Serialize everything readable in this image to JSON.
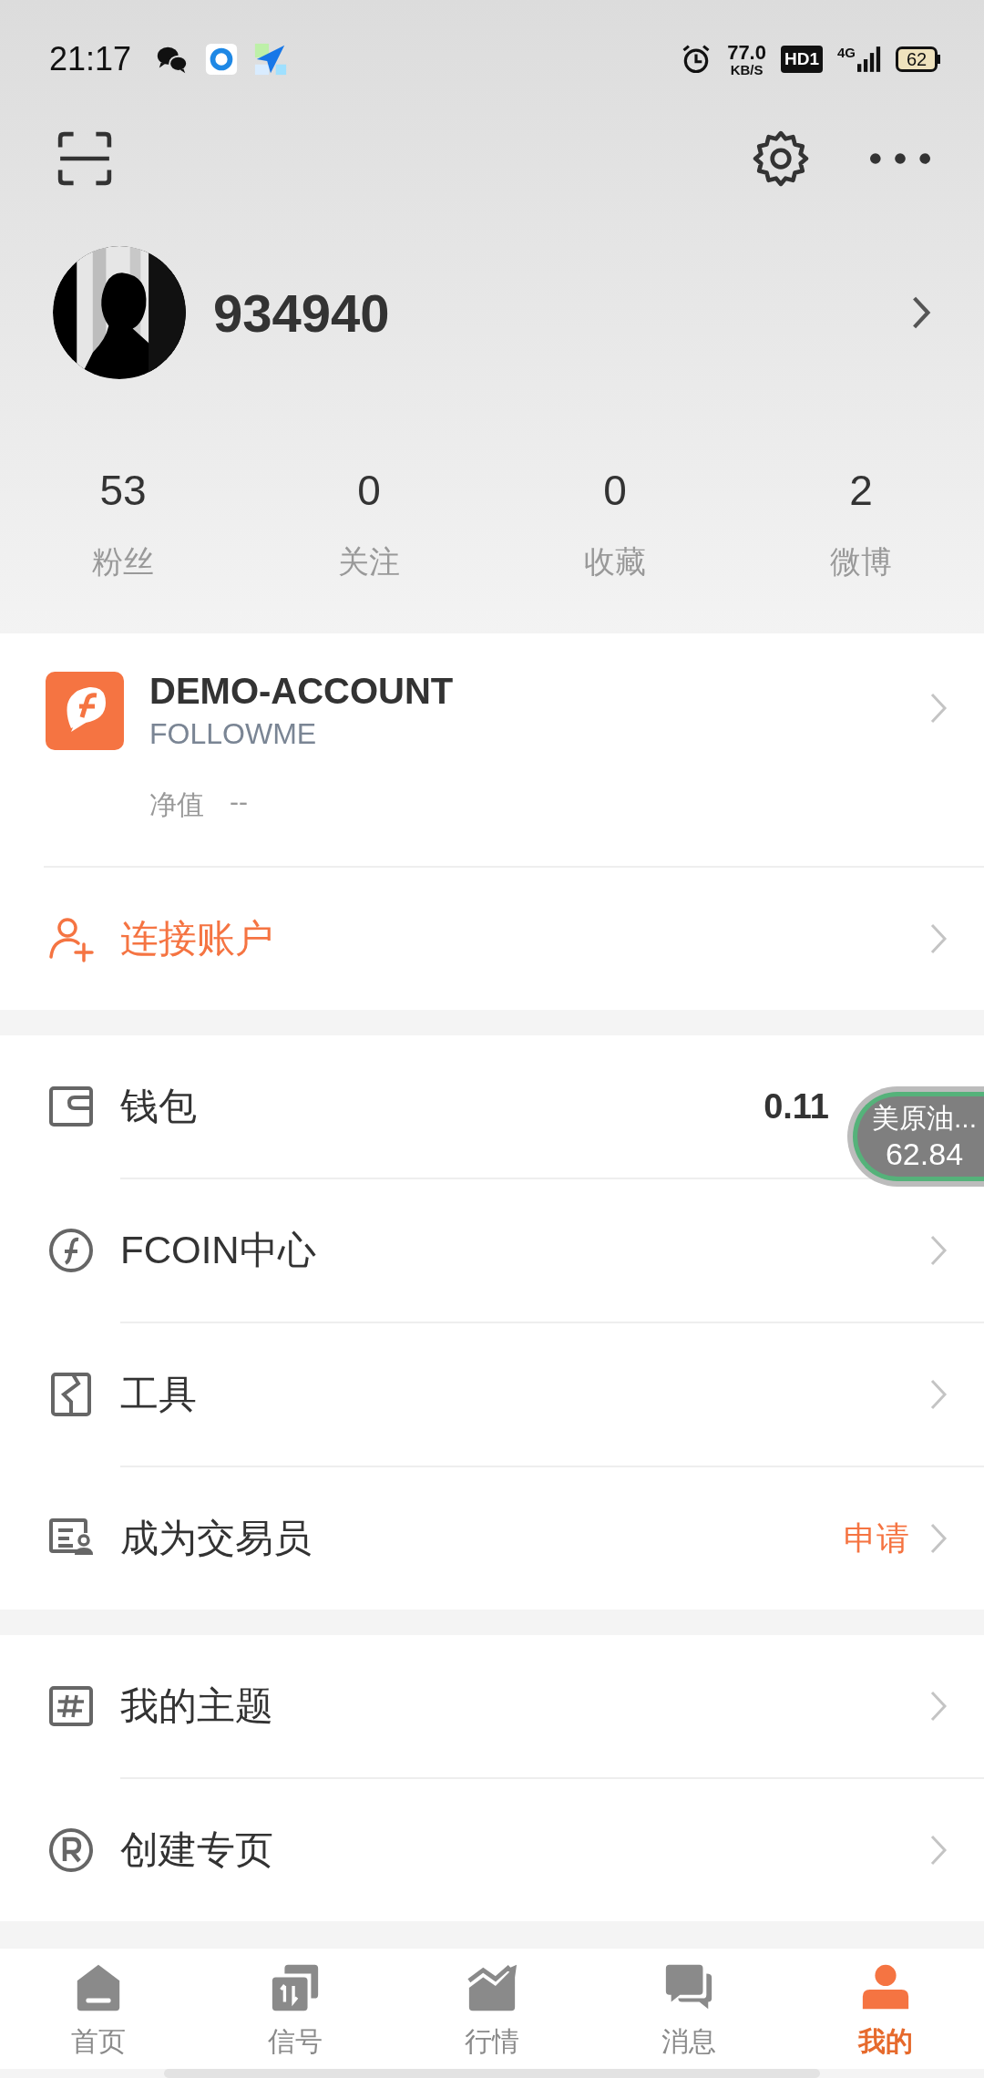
{
  "status_bar": {
    "time": "21:17",
    "network_speed": {
      "value": "77.0",
      "unit": "KB/S"
    },
    "hd_badge": "HD1",
    "network_type": "4G",
    "battery": "62"
  },
  "profile": {
    "name": "934940"
  },
  "stats": [
    {
      "value": "53",
      "label": "粉丝"
    },
    {
      "value": "0",
      "label": "关注"
    },
    {
      "value": "0",
      "label": "收藏"
    },
    {
      "value": "2",
      "label": "微博"
    }
  ],
  "account": {
    "name": "DEMO-ACCOUNT",
    "broker": "FOLLOWME",
    "equity_label": "净值",
    "equity_value": "--"
  },
  "connect_account": {
    "label": "连接账户"
  },
  "menu_sections": [
    [
      {
        "kind": "wallet",
        "label": "钱包",
        "value": {
          "kind": "amount",
          "text": "0.11"
        }
      },
      {
        "kind": "coin",
        "label": "FCOIN中心"
      },
      {
        "kind": "tools",
        "label": "工具"
      },
      {
        "kind": "trader",
        "label": "成为交易员",
        "value": {
          "kind": "action",
          "text": "申请"
        }
      }
    ],
    [
      {
        "kind": "topic",
        "label": "我的主题"
      },
      {
        "kind": "page",
        "label": "创建专页"
      }
    ]
  ],
  "floating_quote": {
    "name": "美原油...",
    "price": "62.84"
  },
  "nav": [
    {
      "kind": "home",
      "label": "首页",
      "selected": false
    },
    {
      "kind": "signal",
      "label": "信号",
      "selected": false
    },
    {
      "kind": "market",
      "label": "行情",
      "selected": false
    },
    {
      "kind": "message",
      "label": "消息",
      "selected": false
    },
    {
      "kind": "me",
      "label": "我的",
      "selected": true
    }
  ]
}
